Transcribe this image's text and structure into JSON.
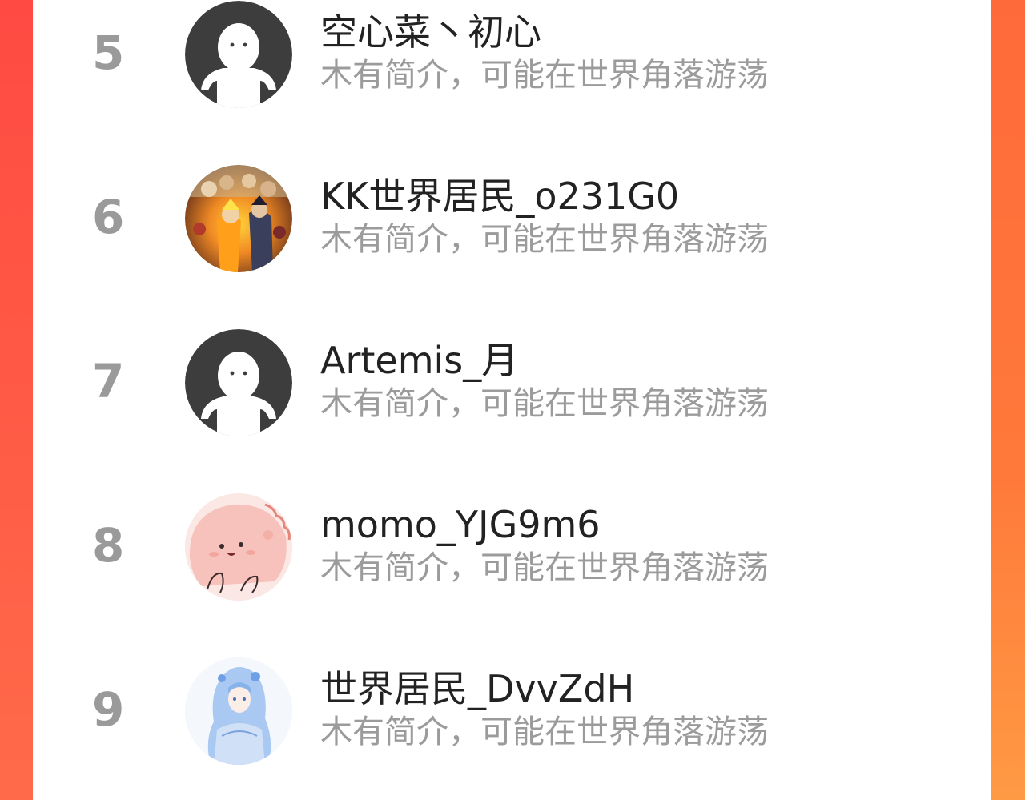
{
  "leaderboard": {
    "accent_left": "#ff4a43",
    "accent_right": "#ff7a3a",
    "rank_color": "#9a9a9a",
    "rows": [
      {
        "rank": "5",
        "name": "空心菜丶初心",
        "bio": "木有简介，可能在世界角落游荡",
        "avatar_icon": "default-avatar-icon"
      },
      {
        "rank": "6",
        "name": "KK世界居民_o231G0",
        "bio": "木有简介，可能在世界角落游荡",
        "avatar_icon": "anime-group-avatar-image"
      },
      {
        "rank": "7",
        "name": "Artemis_月",
        "bio": "木有简介，可能在世界角落游荡",
        "avatar_icon": "default-avatar-icon"
      },
      {
        "rank": "8",
        "name": "momo_YJG9m6",
        "bio": "木有简介，可能在世界角落游荡",
        "avatar_icon": "pink-blob-avatar-image"
      },
      {
        "rank": "9",
        "name": "世界居民_DvvZdH",
        "bio": "木有简介，可能在世界角落游荡",
        "avatar_icon": "blue-hair-girl-avatar-image"
      }
    ]
  }
}
